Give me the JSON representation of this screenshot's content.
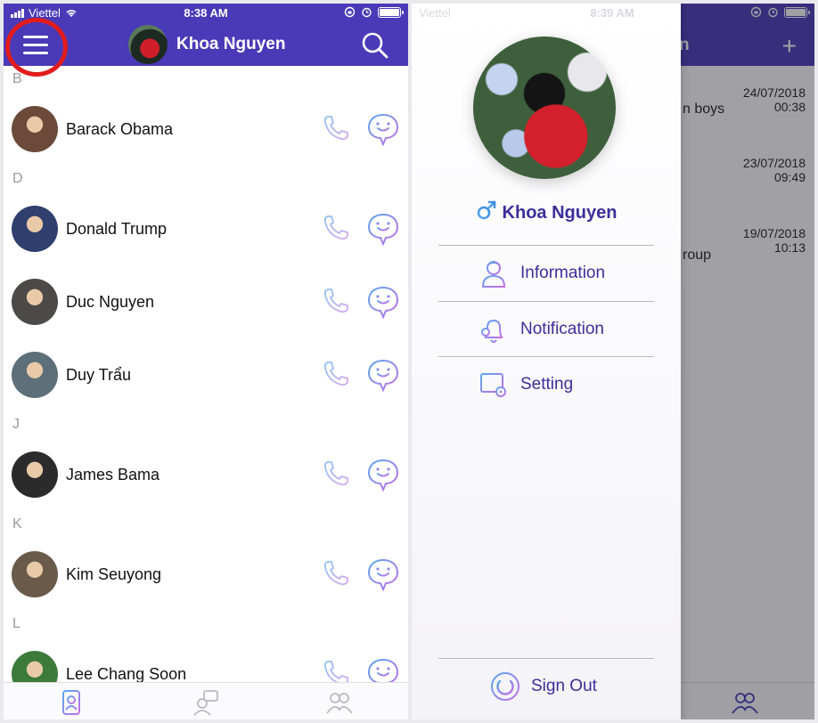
{
  "left": {
    "status": {
      "carrier": "Viettel",
      "time": "8:38 AM"
    },
    "header": {
      "title": "Khoa Nguyen"
    },
    "contacts": [
      {
        "section": "B",
        "items": [
          {
            "name": "Barack Obama",
            "avatar_color": "#6b4a3a"
          }
        ]
      },
      {
        "section": "D",
        "items": [
          {
            "name": "Donald Trump",
            "avatar_color": "#2f3f6e"
          },
          {
            "name": "Duc Nguyen",
            "avatar_color": "#4b4a48"
          },
          {
            "name": "Duy Trẩu",
            "avatar_color": "#5d6f78"
          }
        ]
      },
      {
        "section": "J",
        "items": [
          {
            "name": "James Bama",
            "avatar_color": "#2b2b2b"
          }
        ]
      },
      {
        "section": "K",
        "items": [
          {
            "name": "Kim Seuyong",
            "avatar_color": "#6a5a4a"
          }
        ]
      },
      {
        "section": "L",
        "items": [
          {
            "name": "Lee Chang Soon",
            "avatar_color": "#3c7a3a"
          }
        ]
      }
    ]
  },
  "right": {
    "status": {
      "carrier": "Viettel",
      "time": "8:39 AM"
    },
    "background": {
      "title_fragment": "n",
      "rows": [
        {
          "text": "n boys",
          "date": "24/07/2018",
          "time": "00:38"
        },
        {
          "text": "",
          "date": "23/07/2018",
          "time": "09:49"
        },
        {
          "text": "roup",
          "date": "19/07/2018",
          "time": "10:13"
        }
      ]
    },
    "drawer": {
      "profile_name": "Khoa Nguyen",
      "menu": [
        {
          "label": "Information",
          "icon": "user-info-icon"
        },
        {
          "label": "Notification",
          "icon": "bell-icon"
        },
        {
          "label": "Setting",
          "icon": "settings-panel-icon"
        }
      ],
      "sign_out": "Sign Out"
    }
  },
  "colors": {
    "brand": "#4a3ab8",
    "accent_text": "#3b2f9a",
    "icon_gradient_start": "#5aa7f0",
    "icon_gradient_end": "#c46ee6",
    "annotation_ring": "#e11c1c"
  }
}
